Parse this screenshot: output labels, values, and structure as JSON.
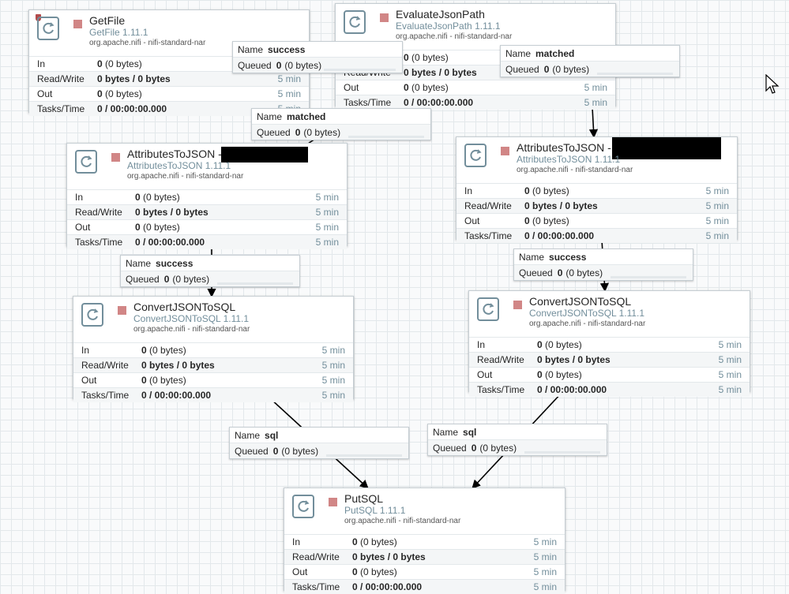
{
  "processors": {
    "getfile": {
      "name": "GetFile",
      "type": "GetFile 1.11.1",
      "bundle": "org.apache.nifi - nifi-standard-nar",
      "in": "0",
      "in_bytes": "(0 bytes)",
      "rw": "0 bytes / 0 bytes",
      "out": "0",
      "out_bytes": "(0 bytes)",
      "tasks": "0 / 00:00:00.000",
      "window": "5 min"
    },
    "evaluatejsonpath": {
      "name": "EvaluateJsonPath",
      "type": "EvaluateJsonPath 1.11.1",
      "bundle": "org.apache.nifi - nifi-standard-nar",
      "in": "0",
      "in_bytes": "(0 bytes)",
      "rw": "0 bytes / 0 bytes",
      "out": "0",
      "out_bytes": "(0 bytes)",
      "tasks": "0 / 00:00:00.000",
      "window": "5 min"
    },
    "attributestojson_left": {
      "name": "AttributesToJSON -",
      "type": "AttributesToJSON 1.11.1",
      "bundle": "org.apache.nifi - nifi-standard-nar",
      "in": "0",
      "in_bytes": "(0 bytes)",
      "rw": "0 bytes / 0 bytes",
      "out": "0",
      "out_bytes": "(0 bytes)",
      "tasks": "0 / 00:00:00.000",
      "window": "5 min"
    },
    "attributestojson_right": {
      "name": "AttributesToJSON -",
      "type": "AttributesToJSON 1.11.1",
      "bundle": "org.apache.nifi - nifi-standard-nar",
      "in": "0",
      "in_bytes": "(0 bytes)",
      "rw": "0 bytes / 0 bytes",
      "out": "0",
      "out_bytes": "(0 bytes)",
      "tasks": "0 / 00:00:00.000",
      "window": "5 min"
    },
    "convertjsontosql_left": {
      "name": "ConvertJSONToSQL",
      "type": "ConvertJSONToSQL 1.11.1",
      "bundle": "org.apache.nifi - nifi-standard-nar",
      "in": "0",
      "in_bytes": "(0 bytes)",
      "rw": "0 bytes / 0 bytes",
      "out": "0",
      "out_bytes": "(0 bytes)",
      "tasks": "0 / 00:00:00.000",
      "window": "5 min"
    },
    "convertjsontosql_right": {
      "name": "ConvertJSONToSQL",
      "type": "ConvertJSONToSQL 1.11.1",
      "bundle": "org.apache.nifi - nifi-standard-nar",
      "in": "0",
      "in_bytes": "(0 bytes)",
      "rw": "0 bytes / 0 bytes",
      "out": "0",
      "out_bytes": "(0 bytes)",
      "tasks": "0 / 00:00:00.000",
      "window": "5 min"
    },
    "putsql": {
      "name": "PutSQL",
      "type": "PutSQL 1.11.1",
      "bundle": "org.apache.nifi - nifi-standard-nar",
      "in": "0",
      "in_bytes": "(0 bytes)",
      "rw": "0 bytes / 0 bytes",
      "out": "0",
      "out_bytes": "(0 bytes)",
      "tasks": "0 / 00:00:00.000",
      "window": "5 min"
    }
  },
  "stat_labels": {
    "in": "In",
    "rw": "Read/Write",
    "out": "Out",
    "tasks": "Tasks/Time"
  },
  "connection_labels": {
    "name": "Name",
    "queued": "Queued"
  },
  "connections": {
    "c1": {
      "name": "success",
      "queued": "0",
      "queued_bytes": "(0 bytes)"
    },
    "c2": {
      "name": "matched",
      "queued": "0",
      "queued_bytes": "(0 bytes)"
    },
    "c3": {
      "name": "matched",
      "queued": "0",
      "queued_bytes": "(0 bytes)"
    },
    "c4": {
      "name": "success",
      "queued": "0",
      "queued_bytes": "(0 bytes)"
    },
    "c5": {
      "name": "success",
      "queued": "0",
      "queued_bytes": "(0 bytes)"
    },
    "c6": {
      "name": "sql",
      "queued": "0",
      "queued_bytes": "(0 bytes)"
    },
    "c7": {
      "name": "sql",
      "queued": "0",
      "queued_bytes": "(0 bytes)"
    }
  },
  "colors": {
    "stopped": "#d18686",
    "accent": "#728e9b",
    "warning": "#b34b4b"
  },
  "icons": {
    "processor": "processor-icon",
    "stopped": "stop-icon",
    "warning": "warning-icon",
    "cursor": "mouse-cursor-icon"
  }
}
